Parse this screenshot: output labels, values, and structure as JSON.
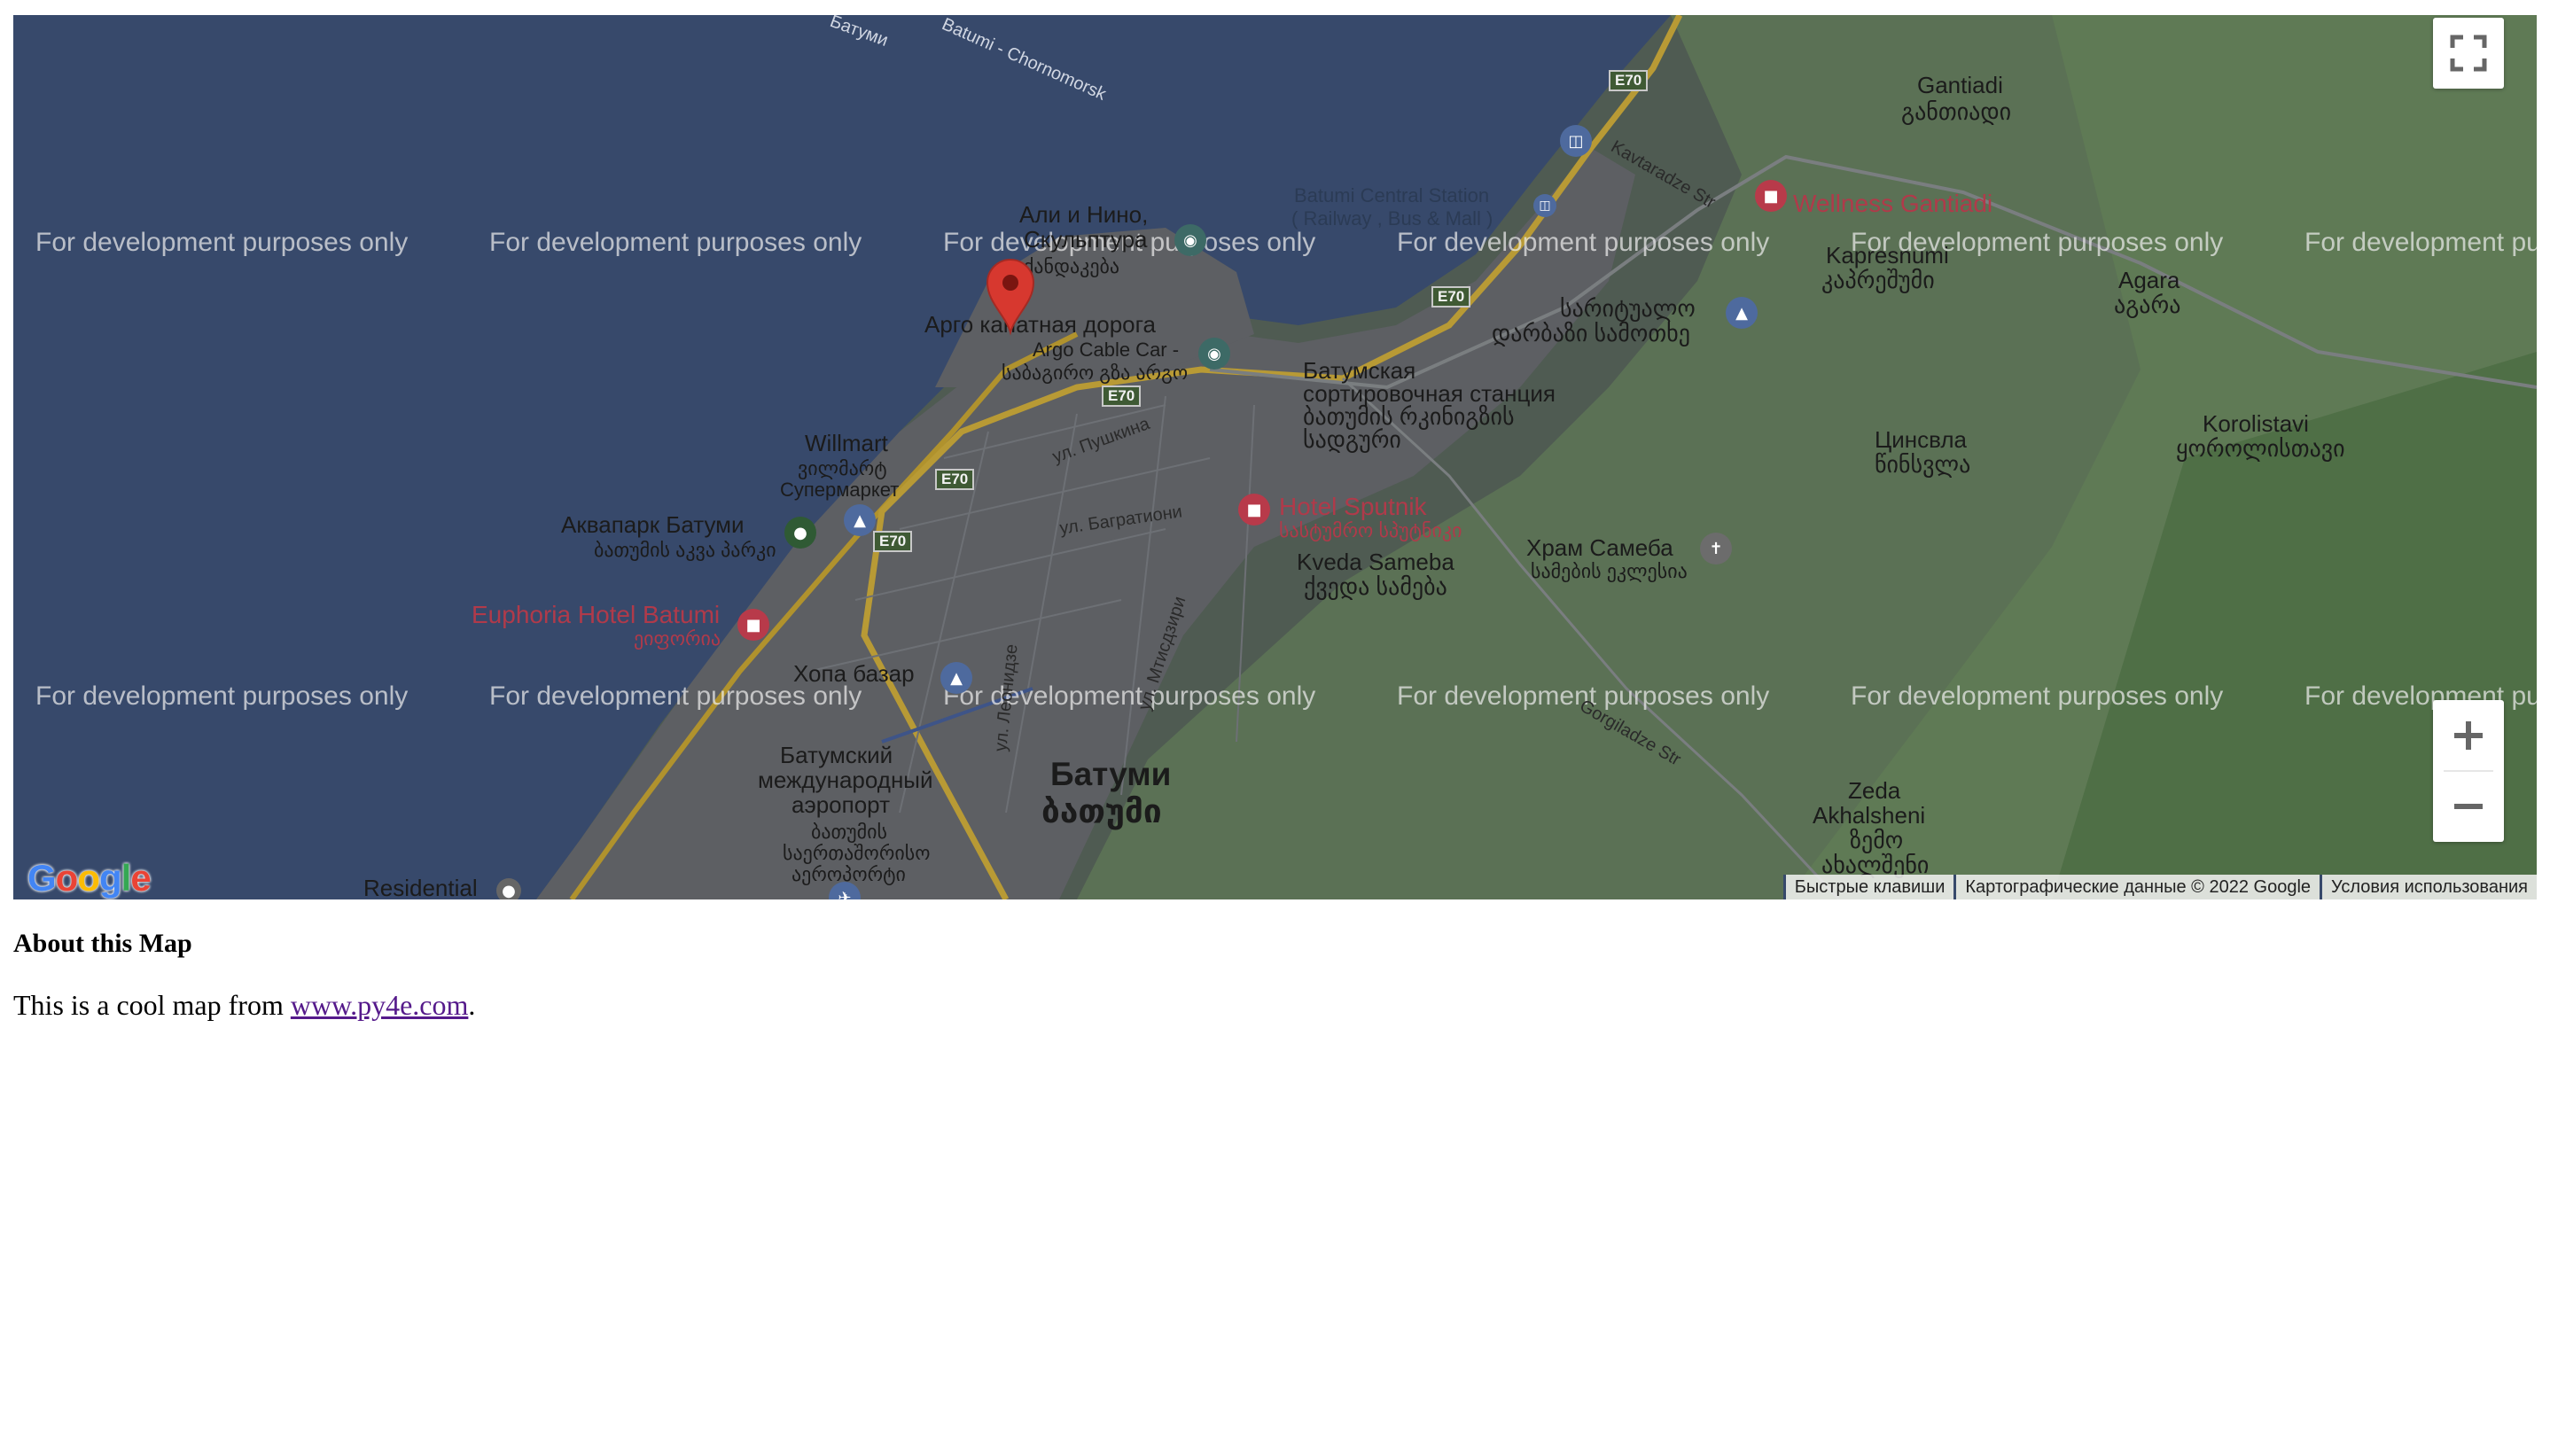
{
  "map": {
    "watermark": "For development purposes only",
    "labels": {
      "gantiadi": "Gantiadi",
      "gantiadi_ka": "განთიადი",
      "wellness": "Wellness Gantiadi",
      "kapresnumi": "Kapresnumi",
      "kapresnumi_ka": "კაპრეშუმი",
      "agara": "Agara",
      "agara_ka": "აგარა",
      "korolistavi": "Korolistavi",
      "korolistavi_ka": "ყოროლისთავი",
      "tsinsvla": "Цинсвла",
      "tsinsvla_ka": "წინსვლა",
      "station": "Batumi Central Station",
      "station2": "( Railway , Bus & Mall )",
      "ali_nino": "Али и Нино,",
      "sculpture": "Скульптура",
      "ali_ka": "ქანდაკება",
      "argo": "Арго канатная дорога",
      "argo_en": "Argo Cable Car -",
      "argo_ka": "საბაგირო გზა არგო",
      "willmart": "Willmart",
      "willmart_ka": "ვილმარტ",
      "supermarket": "Супермаркет",
      "aquapark": "Аквапарк Батуми",
      "aquapark_ka": "ბათუმის აკვა პარკი",
      "euphoria": "Euphoria Hotel Batumi",
      "euphoria_ka": "ეიფორია",
      "khopa": "Хопа базар",
      "airport1": "Батумский",
      "airport2": "международный",
      "airport3": "аэропорт",
      "airport_ka1": "ბათუმის",
      "airport_ka2": "საერთაშორისო",
      "airport_ka3": "აეროპორტი",
      "batumi": "Батуми",
      "batumi_ka": "ბათუმი",
      "residential": "Residential",
      "sort1": "Батумская",
      "sort2": "сортировочная станция",
      "sort_ka1": "ბათუმის რკინიგზის",
      "sort_ka2": "სადგური",
      "sputnik": "Hotel Sputnik",
      "sputnik_ka": "სასტუმრო სპუტნიკი",
      "kveda": "Kveda Sameba",
      "kveda_ka": "ქვედა სამება",
      "hram": "Храм Самеба",
      "hram_ka": "სამების ეკლესია",
      "saritualo": "სარიტუალო",
      "darbazi": "დარბაზი სამოთხე",
      "zeda1": "Zeda",
      "zeda2": "Akhalsheni",
      "zeda_ka1": "ზემო",
      "zeda_ka2": "ახალშენი",
      "pushkina": "ул. Пушкина",
      "bagrationi": "ул. Багратиони",
      "mtsignobari": "ул. Мтисдзири",
      "leonidze": "ул. Леонидзе",
      "kavtaradze": "Kavtaradze Str",
      "tsinamdzgvrishvili": "Gorgiladze Str",
      "batumi_chorokh": "Batumi - Chornomorsk",
      "batumi_top": "Батуми"
    },
    "shields": {
      "e70": "E70"
    },
    "google_logo": "Google",
    "attribution": {
      "shortcuts": "Быстрые клавиши",
      "data": "Картографические данные © 2022 Google",
      "terms": "Условия использования"
    }
  },
  "controls": {
    "fullscreen_icon": "fullscreen-icon",
    "zoom_in_icon": "plus-icon",
    "zoom_out_icon": "minus-icon"
  },
  "about": {
    "heading": "About this Map",
    "text_before": "This is a cool map from ",
    "link": "www.py4e.com",
    "text_after": "."
  }
}
